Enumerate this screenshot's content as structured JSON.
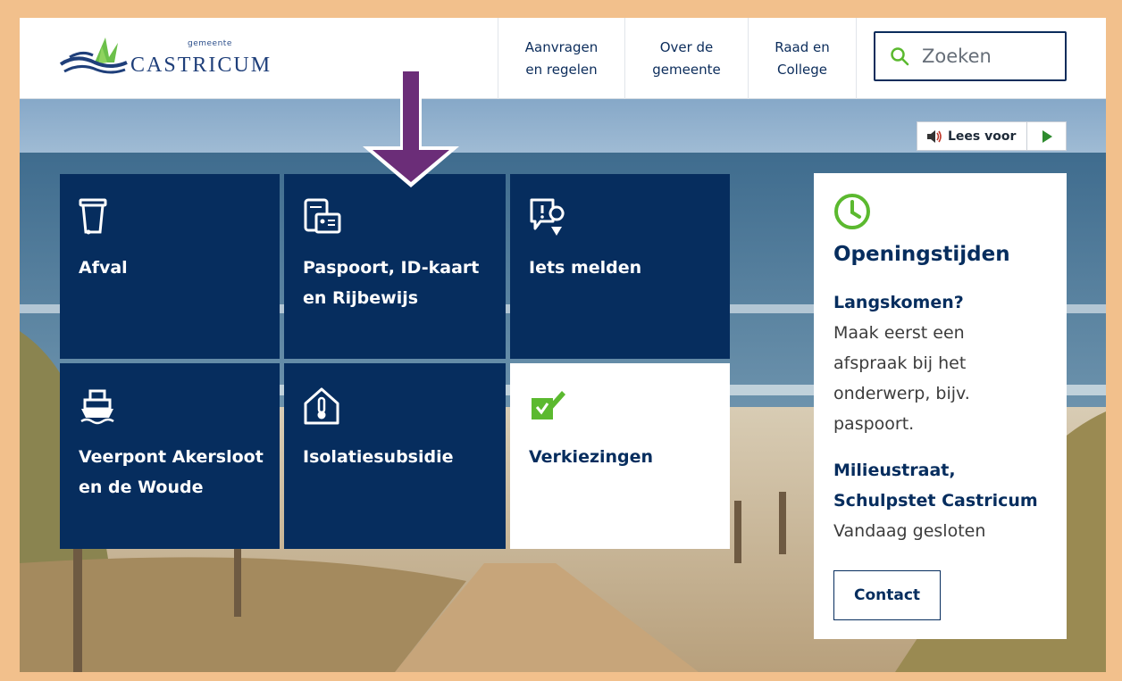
{
  "header": {
    "logo_small": "gemeente",
    "logo_main": "CASTRICUM",
    "nav": [
      {
        "line1": "Aanvragen",
        "line2": "en regelen"
      },
      {
        "line1": "Over de",
        "line2": "gemeente"
      },
      {
        "line1": "Raad en",
        "line2": "College"
      }
    ],
    "search": {
      "placeholder": "Zoeken",
      "icon": "search-icon"
    }
  },
  "readaloud": {
    "label": "Lees voor",
    "icon": "speaker-icon",
    "play_icon": "play-icon"
  },
  "tiles": [
    {
      "label": "Afval",
      "icon": "waste-bin-icon"
    },
    {
      "label": "Paspoort, ID-kaart en Rijbewijs",
      "icon": "id-card-icon"
    },
    {
      "label": "Iets melden",
      "icon": "report-location-icon"
    },
    {
      "label": "Veerpont Akersloot en de Woude",
      "icon": "ferry-icon"
    },
    {
      "label": "Isolatiesubsidie",
      "icon": "house-thermometer-icon"
    },
    {
      "label": "Verkiezingen",
      "icon": "ballot-icon"
    }
  ],
  "hours": {
    "icon": "clock-icon",
    "title": "Openingstijden",
    "sub1": "Langskomen?",
    "text1": "Maak eerst een afspraak bij het onderwerp, bijv. paspoort.",
    "sub2": "Milieustraat, Schulpstet Castricum",
    "text2": "Vandaag gesloten",
    "contact": "Contact"
  },
  "colors": {
    "navy": "#062d5e",
    "green": "#5bb92f",
    "arrow": "#6b2d78",
    "frame": "#f2c08c"
  }
}
